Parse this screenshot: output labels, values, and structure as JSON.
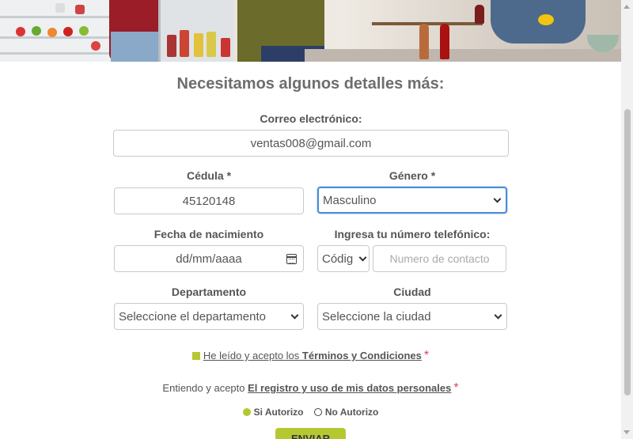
{
  "form": {
    "heading": "Necesitamos algunos detalles más:",
    "email": {
      "label": "Correo electrónico:",
      "value": "ventas008@gmail.com"
    },
    "cedula": {
      "label": "Cédula",
      "required_mark": "*",
      "value": "45120148"
    },
    "genero": {
      "label": "Género",
      "required_mark": "*",
      "value": "Masculino"
    },
    "fecha": {
      "label": "Fecha de nacimiento",
      "placeholder": "dd/mm/aaaa"
    },
    "telefono": {
      "label": "Ingresa tu número telefónico:",
      "code_value": "Códig",
      "number_placeholder": "Numero de contacto"
    },
    "departamento": {
      "label": "Departamento",
      "value": "Seleccione el departamento"
    },
    "ciudad": {
      "label": "Ciudad",
      "value": "Seleccione la ciudad"
    },
    "terms": {
      "prefix": "He leído y acepto los ",
      "link": "Términos y Condiciones",
      "required_mark": "*"
    },
    "consent": {
      "prefix": "Entiendo y acepto ",
      "link": "El registro y uso de mis datos personales",
      "required_mark": "*"
    },
    "radios": {
      "yes_label": "Si Autorizo",
      "no_label": "No Autorizo",
      "selected": "yes"
    },
    "submit_label": "ENVIAR"
  },
  "colors": {
    "accent": "#b5c832",
    "asterisk": "#e0455a",
    "focus": "#4a90d9"
  }
}
